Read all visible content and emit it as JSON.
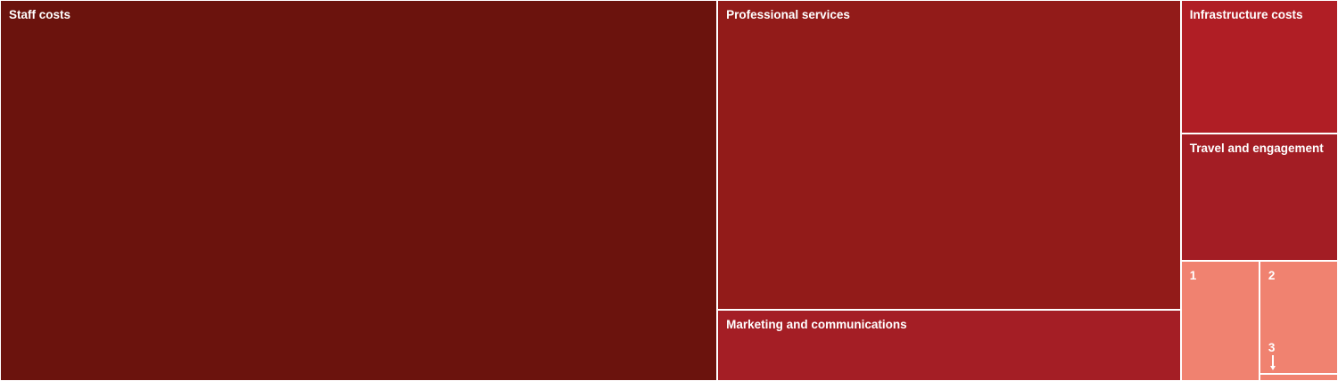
{
  "chart_data": {
    "type": "treemap",
    "title": "",
    "unit": "",
    "items": [
      {
        "label": "Staff costs",
        "value": 52.0,
        "color": "#6b130d"
      },
      {
        "label": "Professional services",
        "value": 27.3,
        "color": "#921b19"
      },
      {
        "label": "Marketing and communications",
        "value": 6.3,
        "color": "#a41e25"
      },
      {
        "label": "Infrastructure costs",
        "value": 4.0,
        "color": "#b01e25"
      },
      {
        "label": "Travel and engagement",
        "value": 3.8,
        "color": "#a31d24"
      },
      {
        "label": "1",
        "value": 1.8,
        "color": "#f08270"
      },
      {
        "label": "2",
        "value": 1.7,
        "color": "#f08270"
      },
      {
        "label": "3",
        "value": 0.1,
        "color": "#f08270",
        "callout": true
      }
    ]
  }
}
